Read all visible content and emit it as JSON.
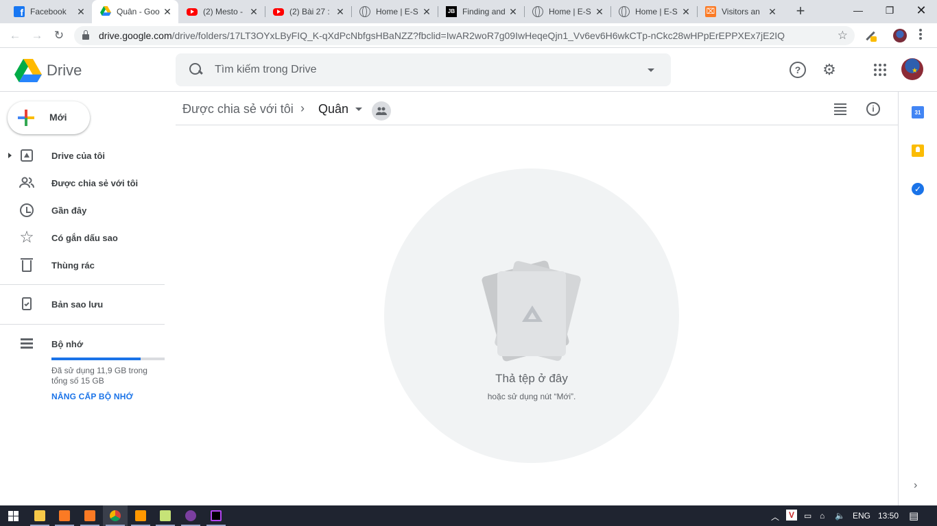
{
  "browser": {
    "tabs": [
      {
        "title": "Facebook",
        "icon": "facebook-icon",
        "active": false
      },
      {
        "title": "Quân - Goo",
        "icon": "google-drive-icon",
        "active": true
      },
      {
        "title": "(2) Mesto -",
        "icon": "youtube-icon",
        "active": false
      },
      {
        "title": "(2) Bài 27 :",
        "icon": "youtube-icon",
        "active": false
      },
      {
        "title": "Home | E-S",
        "icon": "globe-icon",
        "active": false
      },
      {
        "title": "Finding and",
        "icon": "jetbrains-icon",
        "active": false
      },
      {
        "title": "Home | E-S",
        "icon": "globe-icon",
        "active": false
      },
      {
        "title": "Home | E-S",
        "icon": "globe-icon",
        "active": false
      },
      {
        "title": "Visitors an",
        "icon": "xampp-icon",
        "active": false
      }
    ],
    "url_host": "drive.google.com",
    "url_path": "/drive/folders/17LT3OYxLByFIQ_K-qXdPcNbfgsHBaNZZ?fbclid=IwAR2woR7g09IwHeqeQjn1_Vv6ev6H6wkCTp-nCkc28wHPpErEPPXEx7jE2IQ"
  },
  "drive": {
    "logo_text": "Drive",
    "search_placeholder": "Tìm kiếm trong Drive",
    "new_button": "Mới",
    "nav": {
      "my_drive": "Drive của tôi",
      "shared": "Được chia sẻ với tôi",
      "recent": "Gần đây",
      "starred": "Có gắn dấu sao",
      "trash": "Thùng rác",
      "backups": "Bản sao lưu",
      "storage": "Bộ nhớ"
    },
    "storage": {
      "used_fraction": 0.79,
      "text": "Đã sử dụng 11,9 GB trong tổng số 15 GB",
      "upgrade": "NÂNG CẤP BỘ NHỚ"
    },
    "breadcrumb": {
      "parent": "Được chia sẻ với tôi",
      "separator": "›",
      "current": "Quân"
    },
    "empty_state": {
      "title": "Thả tệp ở đây",
      "subtitle": "hoặc sử dụng nút “Mới”."
    },
    "side_panel": {
      "calendar_day": "31"
    }
  },
  "taskbar": {
    "language": "ENG",
    "time": "13:50"
  },
  "colors": {
    "accent": "#1a73e8",
    "tab_strip": "#dee1e6",
    "taskbar": "#1f2430"
  }
}
